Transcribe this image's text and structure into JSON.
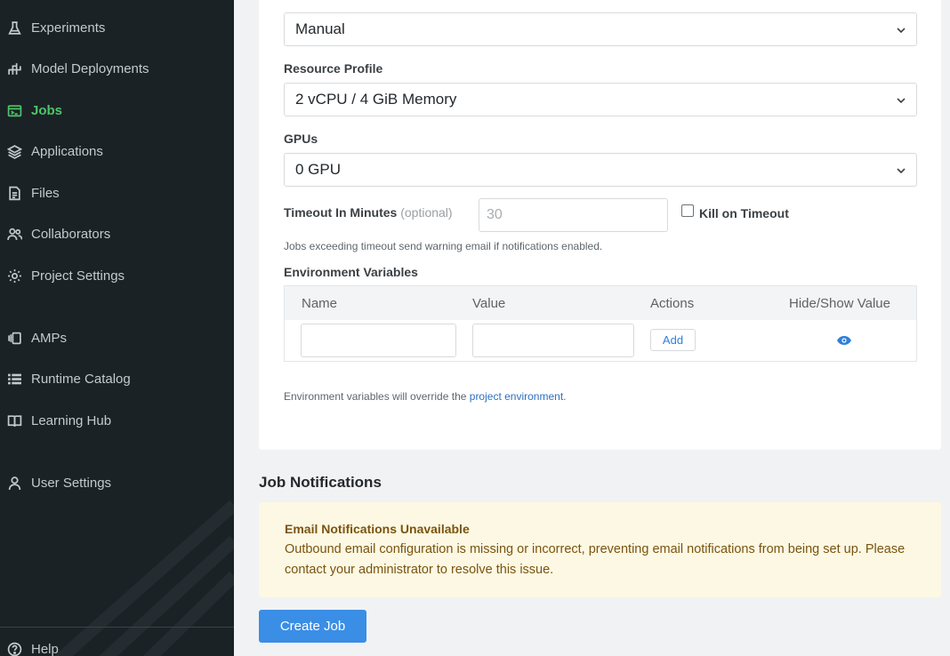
{
  "sidebar": {
    "items": [
      {
        "label": "Experiments",
        "icon": "flask-icon",
        "active": false
      },
      {
        "label": "Model Deployments",
        "icon": "deployments-icon",
        "active": false
      },
      {
        "label": "Jobs",
        "icon": "jobs-icon",
        "active": true
      },
      {
        "label": "Applications",
        "icon": "layers-icon",
        "active": false
      },
      {
        "label": "Files",
        "icon": "file-icon",
        "active": false
      },
      {
        "label": "Collaborators",
        "icon": "users-icon",
        "active": false
      },
      {
        "label": "Project Settings",
        "icon": "gear-icon",
        "active": false
      },
      {
        "label": "AMPs",
        "icon": "amps-icon",
        "active": false
      },
      {
        "label": "Runtime Catalog",
        "icon": "list-icon",
        "active": false
      },
      {
        "label": "Learning Hub",
        "icon": "book-icon",
        "active": false
      },
      {
        "label": "User Settings",
        "icon": "user-icon",
        "active": false
      }
    ],
    "help": {
      "label": "Help",
      "icon": "help-icon"
    }
  },
  "form": {
    "resource_profile": {
      "label": "Resource Profile",
      "value": "2 vCPU / 4 GiB Memory"
    },
    "schedule": {
      "value": "Manual"
    },
    "gpus": {
      "label": "GPUs",
      "value": "0 GPU"
    },
    "timeout": {
      "label": "Timeout In Minutes",
      "optional": "(optional)",
      "placeholder": "30",
      "kill_label": "Kill on Timeout",
      "kill_checked": false,
      "helper": "Jobs exceeding timeout send warning email if notifications enabled."
    },
    "env": {
      "label": "Environment Variables",
      "columns": {
        "name": "Name",
        "value": "Value",
        "actions": "Actions",
        "hide_show": "Hide/Show Value"
      },
      "add_label": "Add",
      "note_prefix": "Environment variables will override the ",
      "note_link": "project environment",
      "note_suffix": "."
    }
  },
  "notifications": {
    "title": "Job Notifications",
    "warning_title": "Email Notifications Unavailable",
    "warning_text": "Outbound email configuration is missing or incorrect, preventing email notifications from being set up. Please contact your administrator to resolve this issue."
  },
  "actions": {
    "create_label": "Create Job"
  },
  "colors": {
    "sidebar_bg": "#1b2226",
    "active_nav": "#4fc46b",
    "primary_button": "#3a8ee6",
    "link": "#2f6fc0",
    "warning_bg": "#fcf8e3",
    "warning_text": "#7a5410"
  }
}
